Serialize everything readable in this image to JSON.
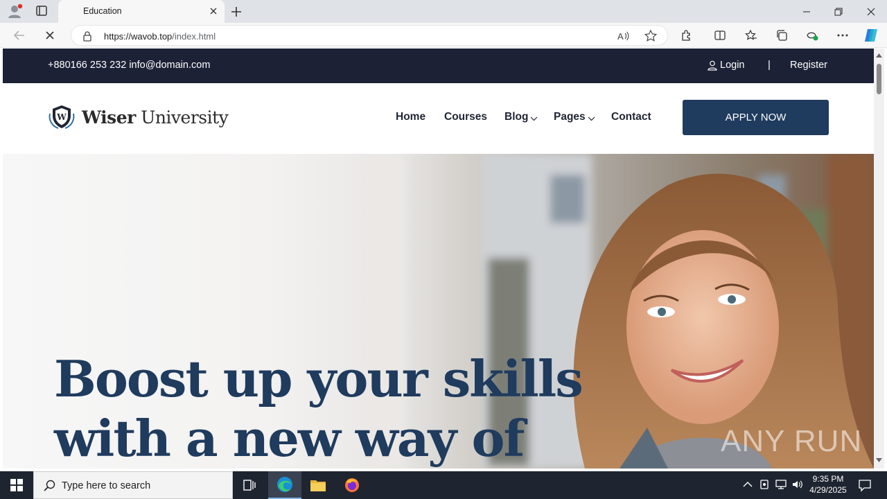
{
  "browser": {
    "tab_title": "Education",
    "url_host": "https://wavob.top",
    "url_path": "/index.html"
  },
  "site": {
    "topbar": {
      "contact": "+880166 253 232 info@domain.com",
      "login": "Login",
      "separator": "|",
      "register": "Register"
    },
    "logo": {
      "name_bold": "Wiser",
      "name_rest": "University"
    },
    "nav": {
      "home": "Home",
      "courses": "Courses",
      "blog": "Blog",
      "pages": "Pages",
      "contact": "Contact"
    },
    "apply_button": "APPLY NOW",
    "hero": {
      "line1": "Boost up your skills",
      "line2": "with a new way of"
    },
    "watermark": "ANY RUN"
  },
  "taskbar": {
    "search_placeholder": "Type here to search",
    "time": "9:35 PM",
    "date": "4/29/2025"
  },
  "colors": {
    "topbar_bg": "#1c2136",
    "brand_navy": "#1f3b5e",
    "taskbar_bg": "#1f2530"
  }
}
